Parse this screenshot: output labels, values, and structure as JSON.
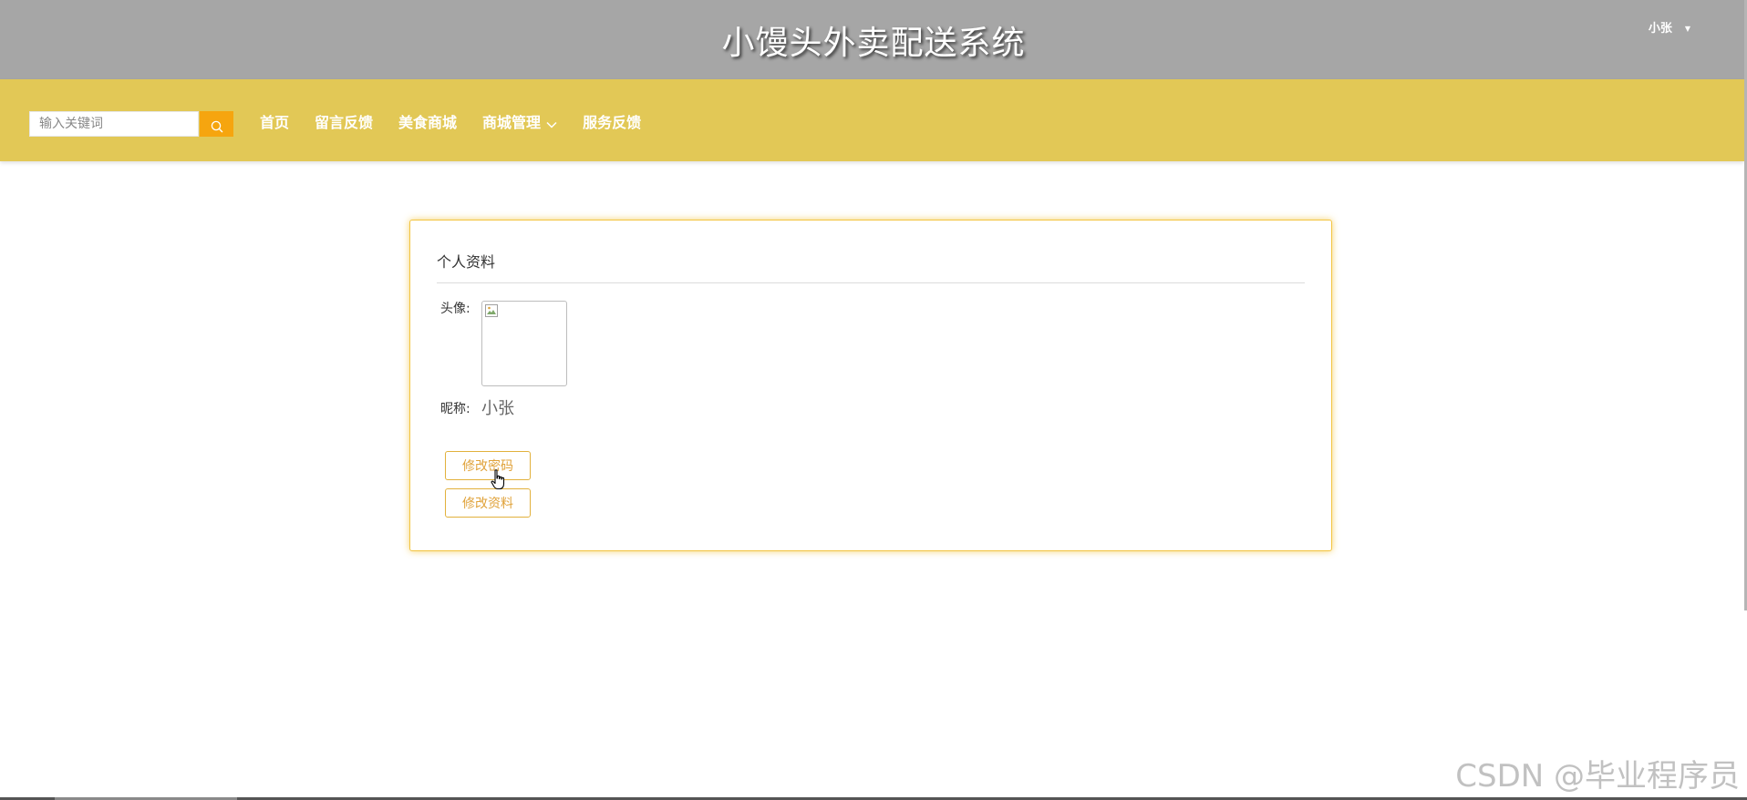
{
  "header": {
    "site_title": "小馒头外卖配送系统",
    "user_name": "小张",
    "user_caret_icon": "caret-down-icon"
  },
  "navbar": {
    "background_color": "#e2c856",
    "search": {
      "placeholder": "输入关键词",
      "value": "",
      "button_icon": "search-icon",
      "button_color": "#f6a50f"
    },
    "items": [
      {
        "label": "首页"
      },
      {
        "label": "留言反馈"
      },
      {
        "label": "美食商城"
      },
      {
        "label": "商城管理",
        "icon": "chevron-down-icon"
      },
      {
        "label": "服务反馈"
      }
    ]
  },
  "profile": {
    "title": "个人资料",
    "avatar_label": "头像:",
    "nickname_label": "昵称:",
    "nickname_value": "小张",
    "change_password_label": "修改密码",
    "edit_profile_label": "修改资料"
  },
  "watermark": "CSDN @毕业程序员",
  "colors": {
    "topbar": "#a6a6a6",
    "accent": "#f3c440",
    "button_text": "#e0a23a"
  }
}
